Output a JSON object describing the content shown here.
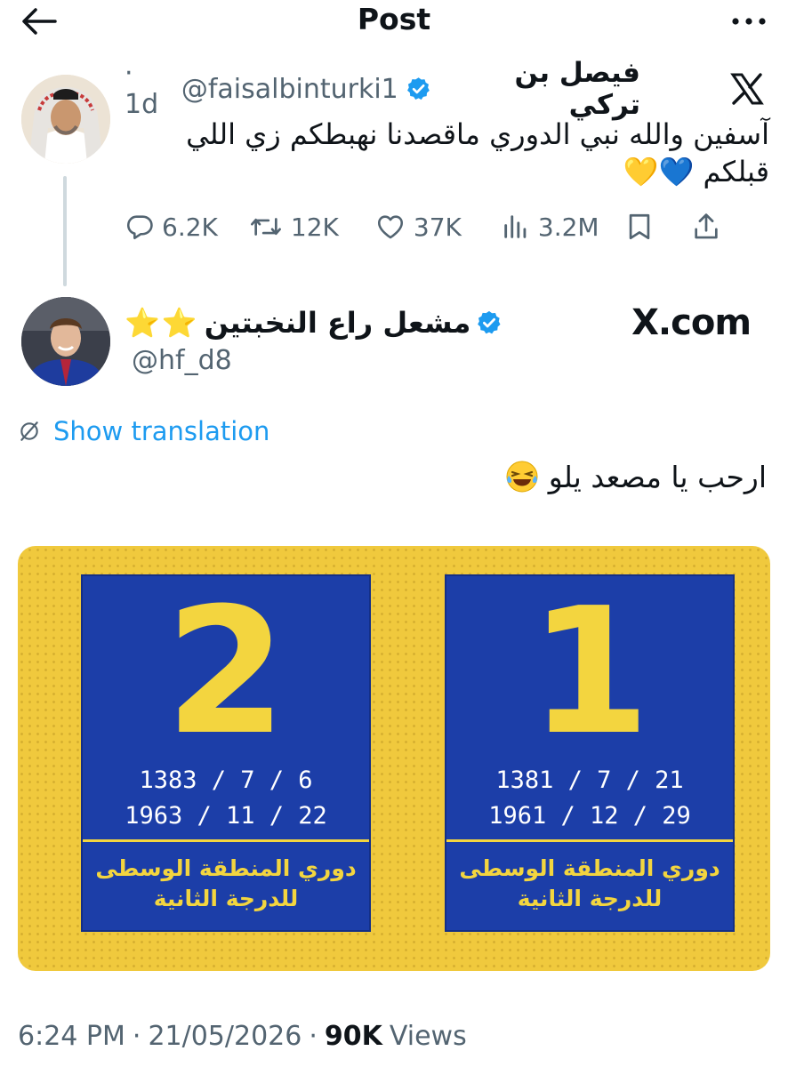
{
  "header": {
    "title": "Post",
    "back_icon": "arrow-left-icon",
    "more_icon": "more-horizontal-icon"
  },
  "quoted_tweet": {
    "display_name": "فيصل بن تركي",
    "handle": "@faisalbinturki1",
    "time": "· 1d",
    "text": "آسفين والله نبي الدوري ماقصدنا نهبطكم زي اللي قبلكم 💙💛",
    "stats": {
      "replies": "6.2K",
      "retweets": "12K",
      "likes": "37K",
      "views": "3.2M"
    }
  },
  "main_tweet": {
    "display_name": "مشعل راع النخبتين",
    "stars": "⭐⭐",
    "handle": "@hf_d8",
    "watermark": "X.com",
    "translate_label": "Show translation",
    "text": "ارحب يا مصعد يلو",
    "media": {
      "cards": [
        {
          "number": "2",
          "date_hijri": "1383 / 7 / 6",
          "date_gregorian": "1963 / 11 / 22",
          "label_line1": "دوري المنطقة الوسطى",
          "label_line2": "للدرجة الثانية"
        },
        {
          "number": "1",
          "date_hijri": "1381 / 7 / 21",
          "date_gregorian": "1961 / 12 / 29",
          "label_line1": "دوري المنطقة الوسطى",
          "label_line2": "للدرجة الثانية"
        }
      ]
    }
  },
  "footer": {
    "time": "6:24 PM",
    "date": "21/05/2026",
    "views_count": "90K",
    "views_label": "Views"
  },
  "colors": {
    "accent": "#1d9bf0",
    "text_secondary": "#536471",
    "card_blue": "#1c3ea8",
    "card_yellow": "#f3d53f",
    "background_yellow": "#f0c93d"
  }
}
